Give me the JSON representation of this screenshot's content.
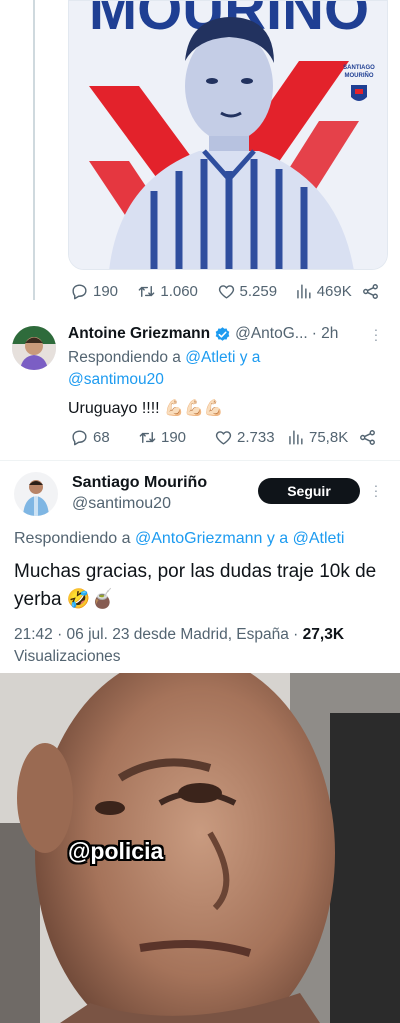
{
  "media": {
    "poster_headline": "MOURIÑO",
    "poster_brand_line1": "SANTIAGO",
    "poster_brand_line2": "MOURIÑO"
  },
  "first_tweet_actions": {
    "replies": "190",
    "retweets": "1.060",
    "likes": "5.259",
    "views": "469K"
  },
  "reply_tweet": {
    "author_name": "Antoine Griezmann",
    "author_handle": "@AntoG...",
    "time": "· 2h",
    "replying_prefix": "Respondiendo a ",
    "replying_mention_1": "@Atleti y a",
    "replying_mention_2": "@santimou20",
    "text": "Uruguayo !!!! 💪🏻💪🏻💪🏻",
    "replies": "68",
    "retweets": "190",
    "likes": "2.733",
    "views": "75,8K"
  },
  "main_tweet": {
    "author_name": "Santiago Mouriño",
    "author_handle": "@santimou20",
    "follow_label": "Seguir",
    "replying_prefix": "Respondiendo a ",
    "replying_mentions": "@AntoGriezmann y a @Atleti",
    "text": "Muchas gracias, por las dudas traje 10k de yerba 🤣🧉",
    "timestamp": "21:42 · 06 jul. 23 desde Madrid, España · ",
    "views_count": "27,3K",
    "views_label": "Visualizaciones"
  },
  "meme": {
    "caption": "@policia"
  },
  "colors": {
    "accent": "#1d9bf0",
    "text": "#0f1419",
    "muted": "#536471",
    "verified": "#1d9bf0",
    "poster_red": "#e3222b",
    "poster_blue": "#1f3f93"
  }
}
